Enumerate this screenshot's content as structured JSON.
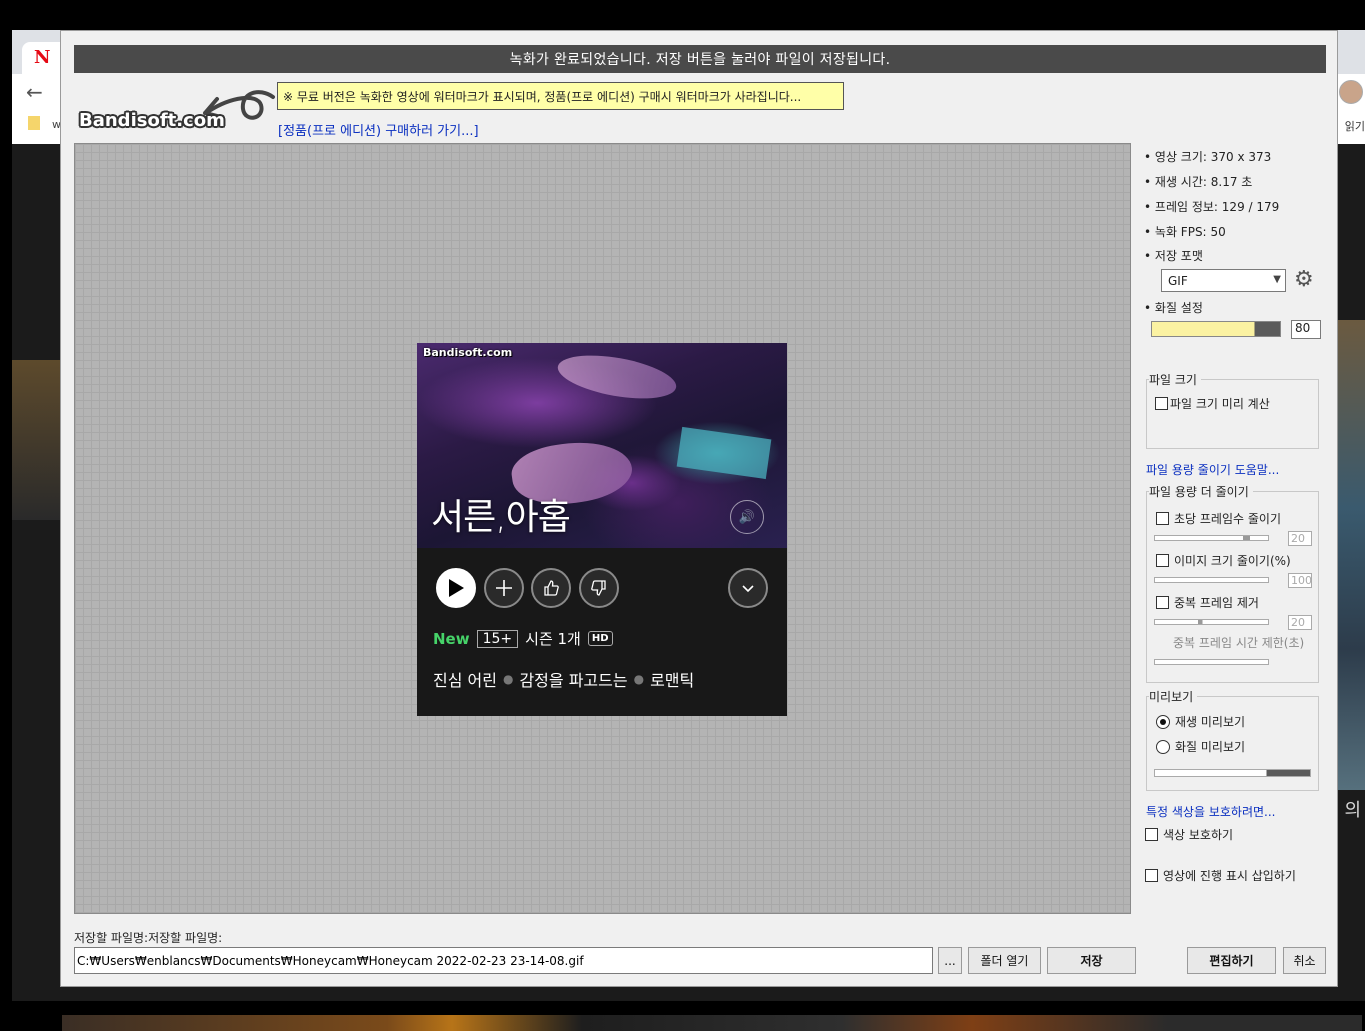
{
  "background": {
    "brand": "N",
    "bookmark_label": "w",
    "reading_list": "읽기",
    "right_text": "의"
  },
  "dialog": {
    "banner": "녹화가 완료되었습니다. 저장 버튼을 눌러야 파일이 저장됩니다.",
    "watermark_logo": "Bandisoft.com",
    "notice": "※ 무료 버전은 녹화한 영상에 워터마크가 표시되며, 정품(프로 에디션) 구매시 워터마크가 사라집니다...",
    "buy_link": "[정품(프로 에디션) 구매하러 가기...]"
  },
  "preview": {
    "watermark": "Bandisoft.com",
    "show_title": "서른,아홉",
    "badge_new": "New",
    "age_rating": "15+",
    "seasons": "시즌 1개",
    "quality_badge": "HD",
    "tags": [
      "진심 어린",
      "감정을 파고드는",
      "로맨틱"
    ],
    "icons": [
      "play-icon",
      "plus-icon",
      "thumbs-up-icon",
      "thumbs-down-icon",
      "chevron-down-icon",
      "volume-icon"
    ]
  },
  "panel": {
    "video_size_label": "영상 크기:",
    "video_size": "370 x 373",
    "duration_label": "재생 시간:",
    "duration": "8.17 초",
    "frame_info_label": "프레임 정보:",
    "frame_info": "129 / 179",
    "fps_label": "녹화 FPS:",
    "fps": "50",
    "format_label": "저장 포맷",
    "format_value": "GIF",
    "quality_label": "화질 설정",
    "quality_value": "80",
    "quality_fraction": 0.8,
    "filesize_group": "파일 크기",
    "filesize_precalc": "파일 크기 미리 계산",
    "reduce_help_link": "파일 용량 줄이기 도움말...",
    "reduce_group": "파일 용량 더 줄이기",
    "reduce_fps": "초당 프레임수 줄이기",
    "reduce_fps_value": "20",
    "reduce_size": "이미지 크기 줄이기(%)",
    "reduce_size_value": "100",
    "remove_dup": "중복 프레임 제거",
    "remove_dup_value": "20",
    "dup_time_limit": "중복 프레임 시간 제한(초)",
    "preview_group": "미리보기",
    "preview_playback": "재생 미리보기",
    "preview_quality": "화질 미리보기",
    "protect_color_link": "특정 색상을 보호하려면...",
    "protect_color": "색상 보호하기",
    "insert_progress": "영상에 진행 표시 삽입하기"
  },
  "bottom": {
    "filename_label": "저장할 파일명:저장할 파일명:",
    "filename": "C:₩Users₩enblancs₩Documents₩Honeycam₩Honeycam 2022-02-23 23-14-08.gif",
    "browse": "...",
    "open_folder": "폴더 열기",
    "save": "저장",
    "edit": "편집하기",
    "cancel": "취소"
  },
  "colors": {
    "banner_bg": "#4a4a4a",
    "notice_bg": "#ffffa8",
    "link": "#0a2fc0",
    "new_badge": "#46d369"
  }
}
